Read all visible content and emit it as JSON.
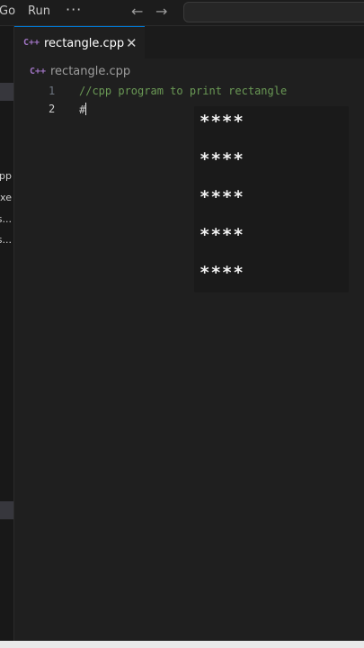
{
  "menu": {
    "go": "Go",
    "run": "Run",
    "more": "···"
  },
  "nav": {
    "back": "←",
    "forward": "→"
  },
  "sidebar": {
    "items": [
      "pp",
      "xe",
      "s...",
      "s..."
    ]
  },
  "tab": {
    "icon": "C++",
    "label": "rectangle.cpp",
    "close": "✕"
  },
  "breadcrumb": {
    "icon": "C++",
    "label": "rectangle.cpp"
  },
  "editor": {
    "lines": [
      {
        "number": "1",
        "text": "//cpp program to print rectangle"
      },
      {
        "number": "2",
        "text": "#"
      }
    ]
  },
  "output": {
    "rows": [
      "****",
      "****",
      "****",
      "****",
      "****"
    ]
  },
  "colors": {
    "accent": "#0078d4",
    "comment": "#6a9955",
    "cpp_icon": "#a074c4",
    "background": "#1f1f1f"
  }
}
